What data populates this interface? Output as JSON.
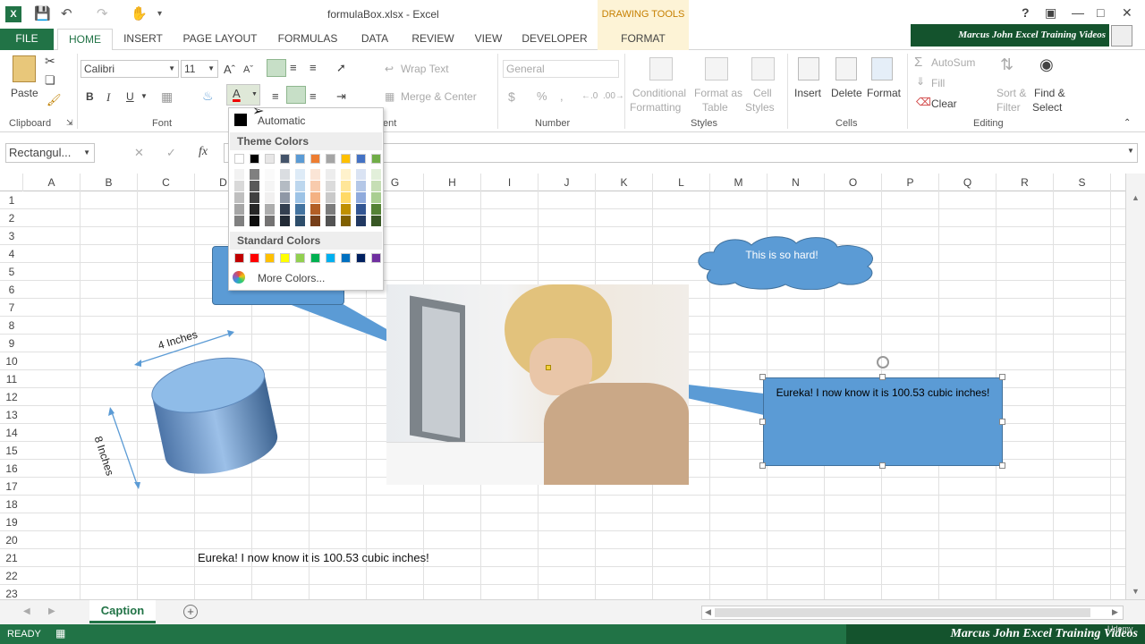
{
  "window": {
    "title": "formulaBox.xlsx - Excel",
    "contextual_group": "DRAWING TOOLS",
    "brand": "Marcus John Excel Training Videos"
  },
  "tabs": [
    "FILE",
    "HOME",
    "INSERT",
    "PAGE LAYOUT",
    "FORMULAS",
    "DATA",
    "REVIEW",
    "VIEW",
    "DEVELOPER",
    "FORMAT"
  ],
  "ribbon": {
    "clipboard": {
      "paste": "Paste",
      "label": "Clipboard"
    },
    "font": {
      "name": "Calibri",
      "size": "11",
      "label": "Font",
      "bold": "B",
      "italic": "I",
      "underline": "U",
      "font_color_glyph": "A"
    },
    "alignment": {
      "wrap": "Wrap Text",
      "merge": "Merge & Center",
      "label": "ent"
    },
    "number": {
      "format": "General",
      "currency": "$",
      "percent": "%",
      "comma": ",",
      "label": "Number"
    },
    "styles": {
      "cond1": "Conditional",
      "cond2": "Formatting",
      "table1": "Format as",
      "table2": "Table",
      "cell1": "Cell",
      "cell2": "Styles",
      "label": "Styles"
    },
    "cells": {
      "insert": "Insert",
      "delete": "Delete",
      "format": "Format",
      "label": "Cells"
    },
    "editing": {
      "autosum": "AutoSum",
      "fill": "Fill",
      "clear": "Clear",
      "sort1": "Sort &",
      "sort2": "Filter",
      "find1": "Find &",
      "find2": "Select",
      "label": "Editing"
    }
  },
  "formula_bar": {
    "name_box": "Rectangul...",
    "fx": "fx",
    "cancel": "✕",
    "enter": "✓"
  },
  "color_dropdown": {
    "automatic": "Automatic",
    "theme_title": "Theme Colors",
    "standard_title": "Standard Colors",
    "more": "More Colors...",
    "theme_top": [
      "#ffffff",
      "#000000",
      "#e7e6e6",
      "#44546a",
      "#5b9bd5",
      "#ed7d31",
      "#a5a5a5",
      "#ffc000",
      "#4472c4",
      "#70ad47"
    ],
    "standard": [
      "#c00000",
      "#ff0000",
      "#ffc000",
      "#ffff00",
      "#92d050",
      "#00b050",
      "#00b0f0",
      "#0070c0",
      "#002060",
      "#7030a0"
    ]
  },
  "columns": [
    "A",
    "B",
    "C",
    "D",
    "E",
    "F",
    "G",
    "H",
    "I",
    "J",
    "K",
    "L",
    "M",
    "N",
    "O",
    "P",
    "Q",
    "R",
    "S"
  ],
  "rows": [
    "1",
    "2",
    "3",
    "4",
    "5",
    "6",
    "7",
    "8",
    "9",
    "10",
    "11",
    "12",
    "13",
    "14",
    "15",
    "16",
    "17",
    "18",
    "19",
    "20",
    "21",
    "22",
    "23"
  ],
  "sheet": {
    "dim_width": "4 Inches",
    "dim_height": "8 Inches",
    "cloud_text": "This is so hard!",
    "callout_text": "Eureka! I now know it is 100.53 cubic inches!",
    "cell_text": "Eureka! I now know it is 100.53 cubic inches!"
  },
  "sheet_tabs": {
    "active": "Caption",
    "add": "+"
  },
  "status": {
    "ready": "READY",
    "brand": "Marcus John Excel Training Videos",
    "udemy": "Udemy"
  },
  "colors": {
    "excel_green": "#217346",
    "shape_blue": "#5b9bd5"
  }
}
